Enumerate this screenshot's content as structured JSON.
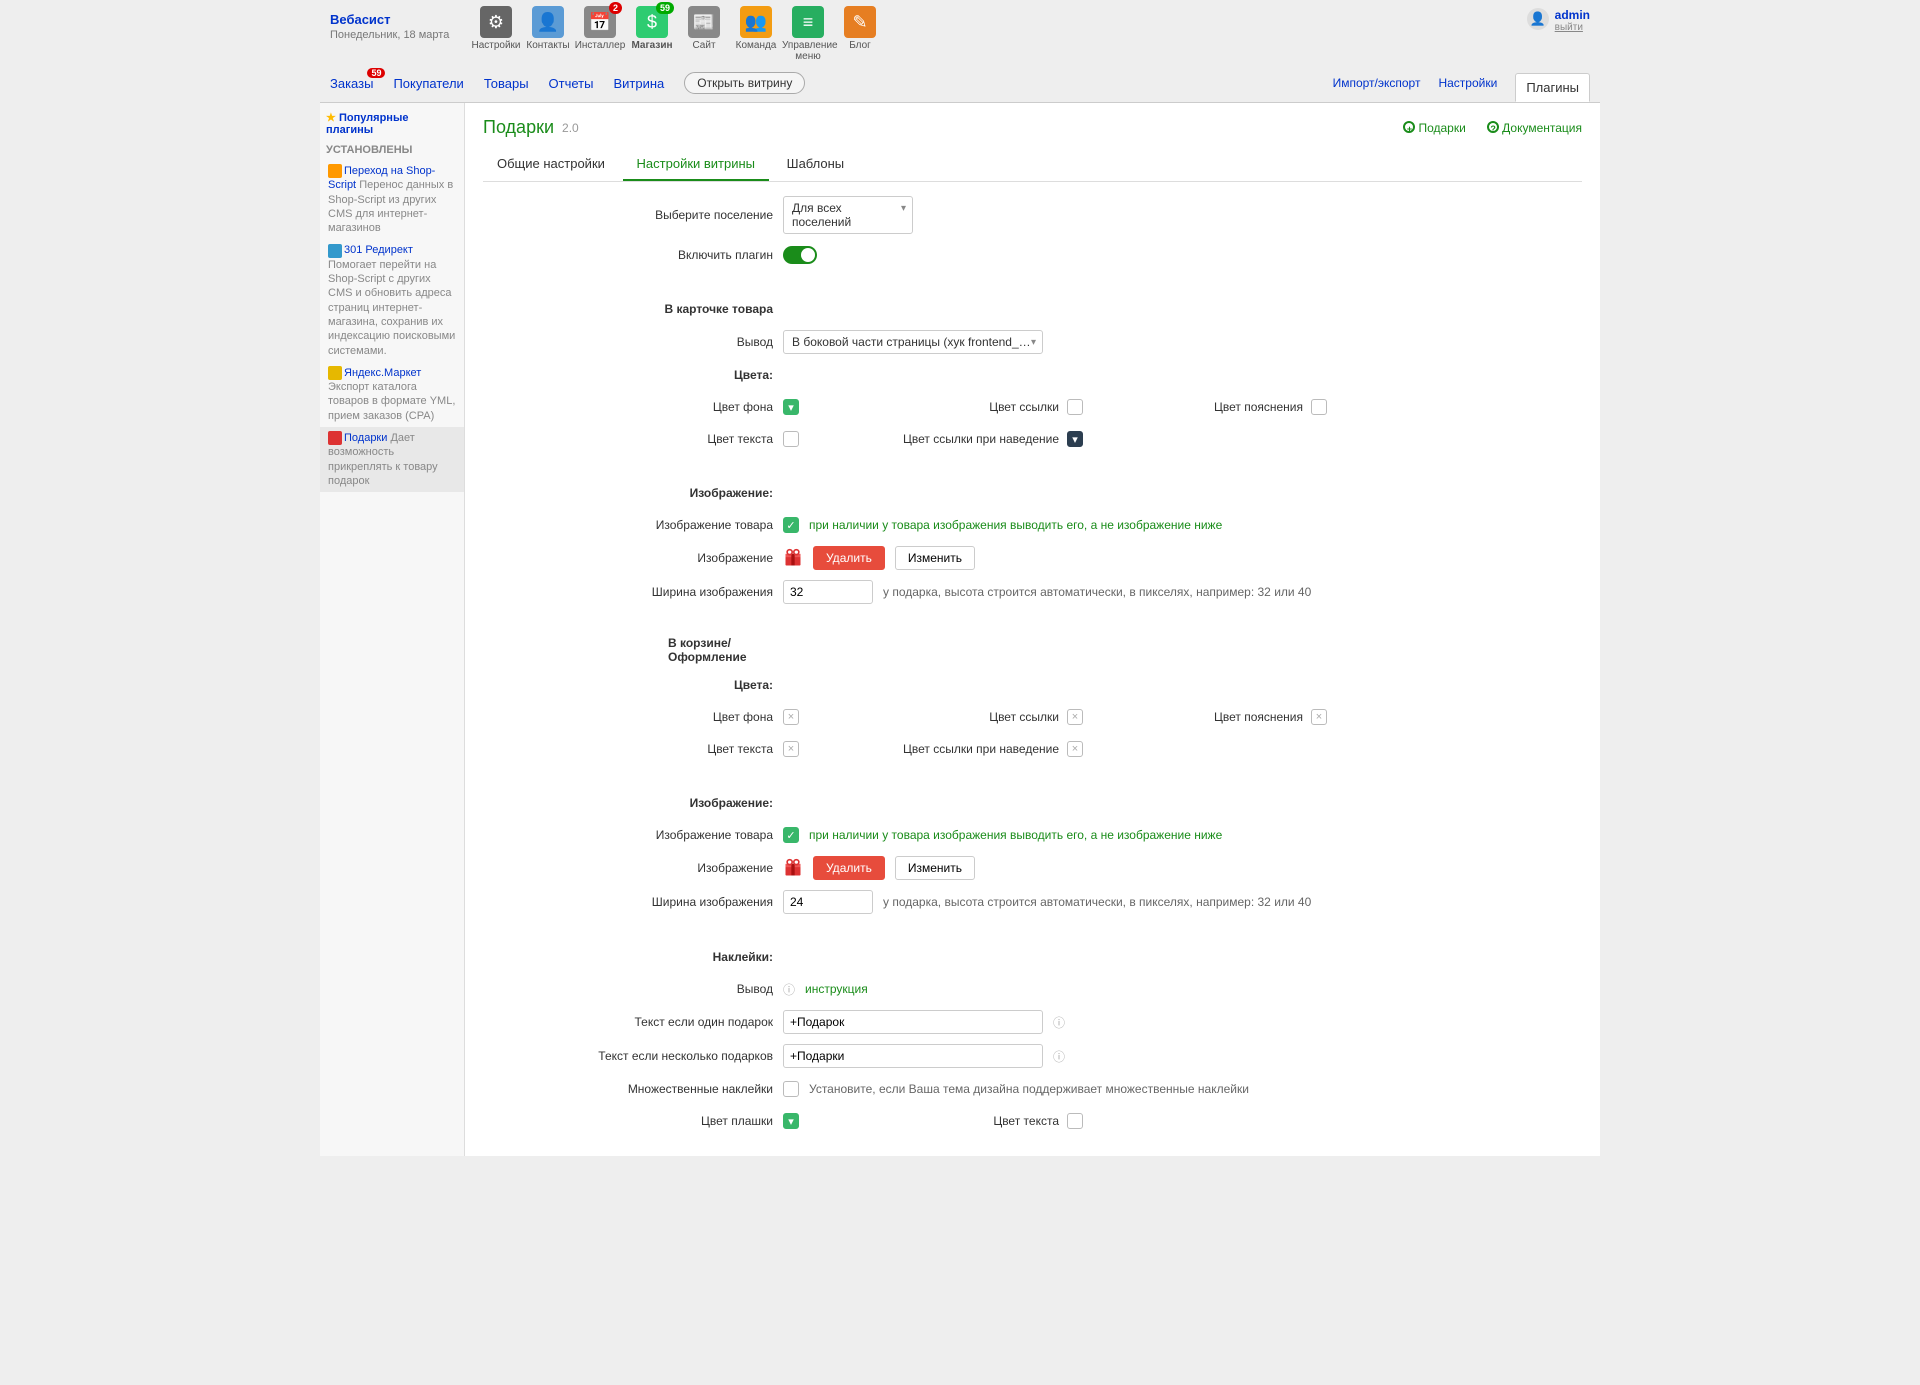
{
  "brand": {
    "name": "Вебасист",
    "date": "Понедельник, 18 марта"
  },
  "apps": [
    {
      "label": "Настройки",
      "icon": "⚙"
    },
    {
      "label": "Контакты",
      "icon": "👤"
    },
    {
      "label": "Инсталлер",
      "icon": "📅",
      "badge": "2",
      "badge_type": "red"
    },
    {
      "label": "Магазин",
      "icon": "$",
      "active": true,
      "badge": "59",
      "badge_type": "green"
    },
    {
      "label": "Сайт",
      "icon": "📰"
    },
    {
      "label": "Команда",
      "icon": "👥"
    },
    {
      "label": "Управление меню",
      "icon": "≡"
    },
    {
      "label": "Блог",
      "icon": "✎"
    }
  ],
  "user": {
    "name": "admin",
    "logout": "выйти"
  },
  "subnav": {
    "items": [
      "Заказы",
      "Покупатели",
      "Товары",
      "Отчеты",
      "Витрина"
    ],
    "orders_badge": "59",
    "open_storefront": "Открыть витрину",
    "right": [
      "Импорт/экспорт",
      "Настройки",
      "Плагины"
    ]
  },
  "sidebar": {
    "popular": "Популярные плагины",
    "installed": "УСТАНОВЛЕНЫ",
    "items": [
      {
        "title": "Переход на Shop-Script",
        "desc": "Перенос данных в Shop-Script из других CMS для интернет-магазинов"
      },
      {
        "title": "301 Редирект",
        "desc": "Помогает перейти на Shop-Script с других CMS и обновить адреса страниц интернет-магазина, сохранив их индексацию поисковыми системами."
      },
      {
        "title": "Яндекс.Маркет",
        "desc": "Экспорт каталога товаров в формате YML, прием заказов (CPA)"
      },
      {
        "title": "Подарки",
        "desc": "Дает возможность прикреплять к товару подарок",
        "active": true
      }
    ]
  },
  "page": {
    "title": "Подарки",
    "version": "2.0",
    "rlinks": {
      "gifts": "Подарки",
      "docs": "Документация"
    },
    "tabs": [
      "Общие настройки",
      "Настройки витрины",
      "Шаблоны"
    ],
    "active_tab": 1
  },
  "form": {
    "select_settlement_label": "Выберите поселение",
    "select_settlement_value": "Для всех поселений",
    "enable_label": "Включить плагин",
    "product_card_head": "В карточке товара",
    "output_label": "Вывод",
    "output_value": "В боковой части страницы (хук frontend_product.block_aux)",
    "colors_head": "Цвета:",
    "bg_color": "Цвет фона",
    "link_color": "Цвет ссылки",
    "note_color": "Цвет пояснения",
    "text_color": "Цвет текста",
    "link_hover": "Цвет ссылки при наведение",
    "image_head": "Изображение:",
    "prod_image_label": "Изображение товара",
    "prod_image_hint": "при наличии у товара изображения выводить его, а не изображение ниже",
    "image_label": "Изображение",
    "delete": "Удалить",
    "change": "Изменить",
    "width_label": "Ширина изображения",
    "width_val1": "32",
    "width_val2": "24",
    "width_hint": "у подарка, высота строится автоматически, в пикселях, например: 32 или 40",
    "cart_head": "В корзине/Оформление",
    "stickers_head": "Наклейки:",
    "instruction": "инструкция",
    "text_one_label": "Текст если один подарок",
    "text_one_val": "+Подарок",
    "text_many_label": "Текст если несколько подарков",
    "text_many_val": "+Подарки",
    "multi_label": "Множественные наклейки",
    "multi_hint": "Установите, если Ваша тема дизайна поддерживает множественные наклейки",
    "badge_color": "Цвет плашки"
  }
}
